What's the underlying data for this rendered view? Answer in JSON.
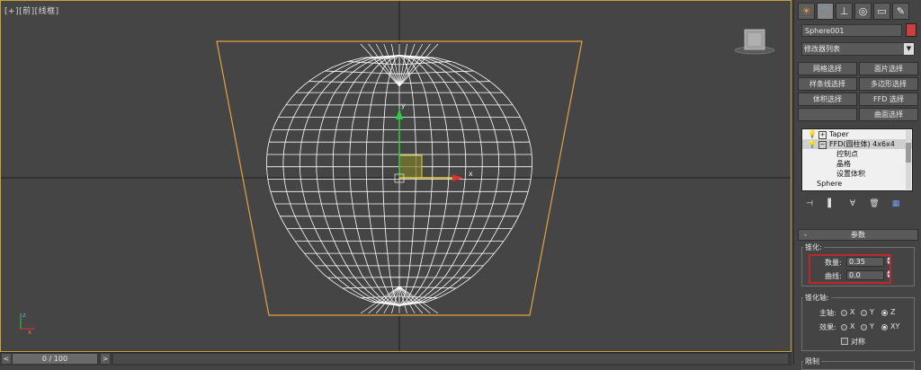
{
  "viewport": {
    "label": "[+][前][线框]",
    "axis_x": "x",
    "axis_y": "y",
    "axis_z": "z"
  },
  "timeline": {
    "prev": "<",
    "frame": "0 / 100",
    "next": ">"
  },
  "panel": {
    "tabs": [
      "create-icon",
      "modify-icon",
      "hierarchy-icon",
      "motion-icon",
      "display-icon",
      "utilities-icon"
    ],
    "object_name": "Sphere001",
    "object_color": "#c9403f",
    "modifier_list": "修改器列表",
    "buttons": {
      "mesh_select": "网格选择",
      "patch_select": "面片选择",
      "spline_select": "样条线选择",
      "poly_select": "多边形选择",
      "vol_select": "体积选择",
      "ffd_select": "FFD 选择",
      "surface_select": "曲面选择"
    },
    "stack": {
      "taper": "Taper",
      "ffd": "FFD(圆柱体) 4x6x4",
      "control_points": "控制点",
      "lattice": "晶格",
      "set_volume": "设置体积",
      "sphere": "Sphere"
    },
    "params": {
      "collapse": "-",
      "title": "参数",
      "taper_group": "锥化:",
      "amount_label": "数量:",
      "amount_value": "0.35",
      "curve_label": "曲线:",
      "curve_value": "0.0",
      "axis_group": "锥化轴:",
      "primary_label": "主轴:",
      "effect_label": "效果:",
      "opt_x": "X",
      "opt_y": "Y",
      "opt_z": "Z",
      "opt_xy": "XY",
      "symmetry": "对称",
      "limit_group": "限制"
    }
  },
  "colors": {
    "viewport_bg": "#454545",
    "wire": "#ffffff",
    "taper_gizmo": "#e6a23c",
    "highlight": "#c0252a"
  }
}
